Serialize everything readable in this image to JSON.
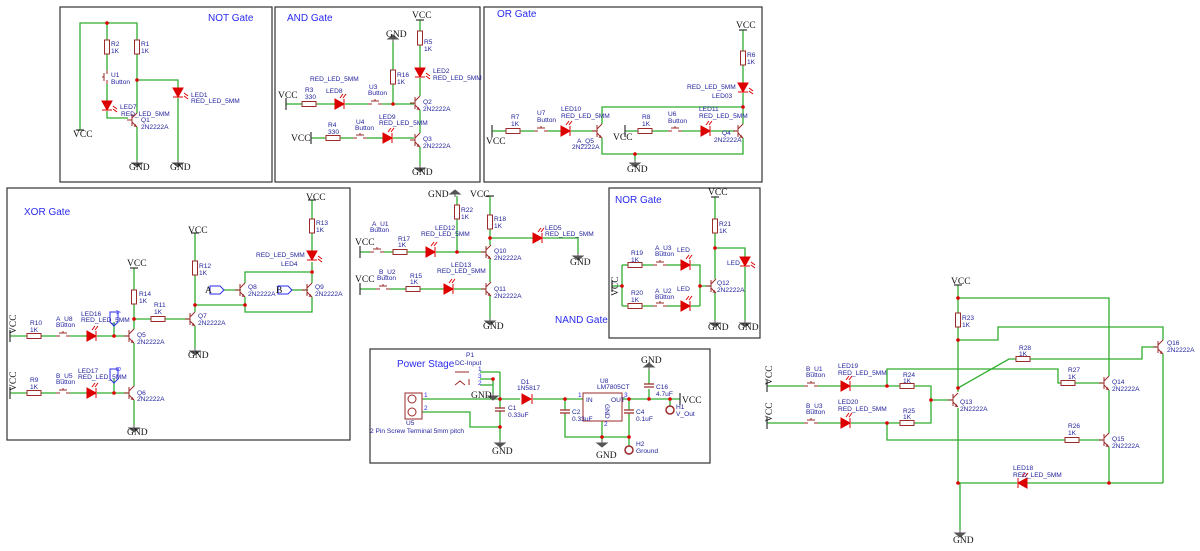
{
  "colors": {
    "wire": "#2fae2f",
    "component": "#9b2a2a",
    "led": "#dd0000",
    "label": "#1f1f9c",
    "title": "#2a2af0",
    "junction": "#dd0000"
  },
  "power": {
    "vcc": "VCC",
    "gnd": "GND"
  },
  "not_gate": {
    "title": "NOT Gate",
    "r2": "R2",
    "r2_v": "1K",
    "r1": "R1",
    "r1_v": "1K",
    "u1": "U1",
    "u1_t": "Button",
    "led7": "LED7",
    "led7_t": "RED_LED_5MM",
    "q1": "Q1",
    "q1_t": "2N2222A",
    "led1": "LED1",
    "led1_t": "RED_LED_5MM"
  },
  "and_gate": {
    "title": "AND Gate",
    "r5": "R5",
    "r5_v": "1K",
    "led2": "LED2",
    "led2_t": "RED_LED_5MM",
    "r16": "R16",
    "r16_v": "1K",
    "led8_t": "RED_LED_5MM",
    "led8": "LED8",
    "r3": "R3",
    "r3_v": "330",
    "u3": "U3",
    "u3_t": "Button",
    "q2": "Q2",
    "q2_t": "2N2222A",
    "r4": "R4",
    "r4_v": "330",
    "u4": "U4",
    "u4_t": "Button",
    "led9": "LED9",
    "led9_t": "RED_LED_5MM",
    "q3": "Q3",
    "q3_t": "2N2222A"
  },
  "or_gate": {
    "title": "OR Gate",
    "r6": "R6",
    "r6_v": "1K",
    "led3_t": "RED_LED_5MM",
    "led3": "LED03",
    "r7": "R7",
    "r7_v": "1K",
    "u7": "U7",
    "u7_t": "Button",
    "led10": "LED10",
    "led10_t": "RED_LED_5MM",
    "q5": "A_Q5",
    "q5_t": "2N2222A",
    "r8": "R8",
    "r8_v": "1K",
    "u6": "U6",
    "u6_t": "Button",
    "led11": "LED11",
    "led11_t": "RED_LED_5MM",
    "q4": "Q4",
    "q4_t": "2N2222A"
  },
  "xor_gate": {
    "title": "XOR Gate",
    "r13": "R13",
    "r13_v": "1K",
    "led4_t": "RED_LED_5MM",
    "led4": "LED4",
    "r12": "R12",
    "r12_v": "1K",
    "q8": "Q8",
    "q8_t": "2N2222A",
    "q9": "Q9",
    "q9_t": "2N2222A",
    "port_a": "A",
    "port_b": "B",
    "r14": "R14",
    "r14_v": "1K",
    "r11": "R11",
    "r11_v": "1K",
    "q7": "Q7",
    "q7_t": "2N2222A",
    "r10": "R10",
    "r10_v": "1K",
    "u8": "A_U8",
    "u8_t": "Button",
    "led16": "LED16",
    "led16_t": "RED_LED_5MM",
    "q5": "Q5",
    "q5_t": "2N2222A",
    "r9": "R9",
    "r9_v": "1K",
    "u5": "B_U5",
    "u5_t": "Button",
    "led17": "LED17",
    "led17_t": "RED_LED_5MM",
    "q6": "Q6",
    "q6_t": "2N2222A",
    "probe_a": "A",
    "probe_b": "B"
  },
  "nand_gate": {
    "title": "NAND Gate",
    "u1": "A_U1",
    "u1_t": "Button",
    "r17": "R17",
    "r17_v": "1K",
    "led12": "LED12",
    "led12_t": "RED_LED_5MM",
    "r22": "R22",
    "r22_v": "1K",
    "r18": "R18",
    "r18_v": "1K",
    "led5": "LED5",
    "led5_t": "RED_LED_5MM",
    "q10": "Q10",
    "q10_t": "2N2222A",
    "u2": "B_U2",
    "u2_t": "Button",
    "r15": "R15",
    "r15_v": "1K",
    "led13": "LED13",
    "led13_t": "RED_LED_5MM",
    "q11": "Q11",
    "q11_t": "2N2222A"
  },
  "nor_gate": {
    "title": "NOR Gate",
    "r21": "R21",
    "r21_v": "1K",
    "led_out": "LED",
    "q12": "Q12",
    "q12_t": "2N2222A",
    "r19": "R19",
    "r19_v": "1K",
    "u3": "A_U3",
    "u3_t": "Button",
    "led_a": "LED",
    "r20": "R20",
    "r20_v": "1K",
    "u2": "A_U2",
    "u2_t": "Button",
    "led_b": "LED"
  },
  "power_stage": {
    "title": "Power Stage",
    "p1": "P1",
    "p1_t": "DC-Input",
    "p1_pin1": "1",
    "p1_pin3": "3",
    "p1_pin2": "2",
    "u5": "U5",
    "u5_t": "2 Pin Screw Terminal 5mm pitch",
    "u5_pin1": "1",
    "u5_pin2": "2",
    "c1": "C1",
    "c1_v": "0.33uF",
    "d1": "D1",
    "d1_t": "1N5817",
    "u8": "U8",
    "u8_t": "LM7805CT",
    "u8_in": "IN",
    "u8_out": "OUT",
    "u8_gnd": "GND",
    "u8_pin1": "1",
    "u8_pin3": "3",
    "u8_pin2": "2",
    "c2": "C2",
    "c2_v": "0.33uF",
    "c4": "C4",
    "c4_v": "0.1uF",
    "c16": "C16",
    "c16_v": "4.7uF",
    "h1": "H1",
    "h1_t": "V_Out",
    "h2": "H2",
    "h2_t": "Ground"
  },
  "adder": {
    "r23": "R23",
    "r23_v": "1K",
    "r28": "R28",
    "r28_v": "1K",
    "q16": "Q16",
    "q16_t": "2N2222A",
    "u1": "B_U1",
    "u1_t": "Button",
    "led19": "LED19",
    "led19_t": "RED_LED_5MM",
    "r24": "R24",
    "r24_v": "1K",
    "r27": "R27",
    "r27_v": "1K",
    "q14": "Q14",
    "q14_t": "2N2222A",
    "q13": "Q13",
    "q13_t": "2N2222A",
    "u3": "B_U3",
    "u3_t": "Button",
    "led20": "LED20",
    "led20_t": "RED_LED_5MM",
    "r25": "R25",
    "r25_v": "1K",
    "r26": "R26",
    "r26_v": "1K",
    "q15": "Q15",
    "q15_t": "2N2222A",
    "led18": "LED18",
    "led18_t": "RED_LED_5MM"
  }
}
